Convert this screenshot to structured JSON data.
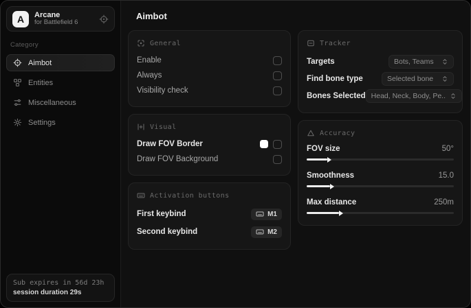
{
  "colors": {
    "window_bg": "#101010",
    "sidebar_bg": "#0b0b0b",
    "card_bg": "#161616",
    "accent": "#ffffff",
    "fov_border_color": "#ffffff"
  },
  "sidebar": {
    "logo_letter": "A",
    "app_name": "Arcane",
    "app_subtitle": "for Battlefield 6",
    "category_label": "Category",
    "items": [
      {
        "label": "Aimbot",
        "active": true
      },
      {
        "label": "Entities",
        "active": false
      },
      {
        "label": "Miscellaneous",
        "active": false
      },
      {
        "label": "Settings",
        "active": false
      }
    ],
    "footer": {
      "line1": "Sub expires in 56d 23h",
      "line2": "session duration 29s"
    }
  },
  "main": {
    "title": "Aimbot",
    "general": {
      "title": "General",
      "rows": [
        {
          "label": "Enable",
          "checked": false
        },
        {
          "label": "Always",
          "checked": false
        },
        {
          "label": "Visibility check",
          "checked": false
        }
      ]
    },
    "visual": {
      "title": "Visual",
      "rows": [
        {
          "label": "Draw FOV Border",
          "swatch": "#ffffff",
          "checked": false
        },
        {
          "label": "Draw FOV Background",
          "checked": false
        }
      ]
    },
    "activation": {
      "title": "Activation buttons",
      "rows": [
        {
          "label": "First keybind",
          "key": "M1"
        },
        {
          "label": "Second keybind",
          "key": "M2"
        }
      ]
    },
    "tracker": {
      "title": "Tracker",
      "rows": [
        {
          "label": "Targets",
          "value": "Bots, Teams"
        },
        {
          "label": "Find bone type",
          "value": "Selected bone"
        },
        {
          "label": "Bones Selected",
          "value": "Head, Neck, Body, Pe..."
        }
      ]
    },
    "accuracy": {
      "title": "Accuracy",
      "rows": [
        {
          "label": "FOV size",
          "value": "50°",
          "fill_pct": 14
        },
        {
          "label": "Smoothness",
          "value": "15.0",
          "fill_pct": 16
        },
        {
          "label": "Max distance",
          "value": "250m",
          "fill_pct": 22
        }
      ]
    }
  }
}
